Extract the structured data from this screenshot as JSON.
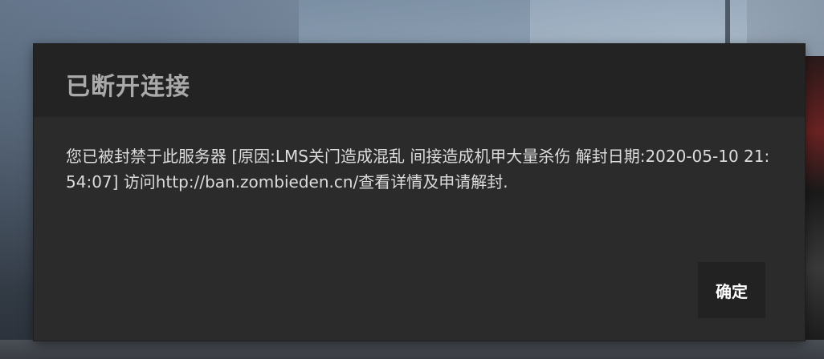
{
  "dialog": {
    "title": "已断开连接",
    "message": "您已被封禁于此服务器 [原因:LMS关门造成混乱 间接造成机甲大量杀伤 解封日期:2020-05-10 21:54:07] 访问http://ban.zombieden.cn/查看详情及申请解封.",
    "confirm_label": "确定"
  }
}
